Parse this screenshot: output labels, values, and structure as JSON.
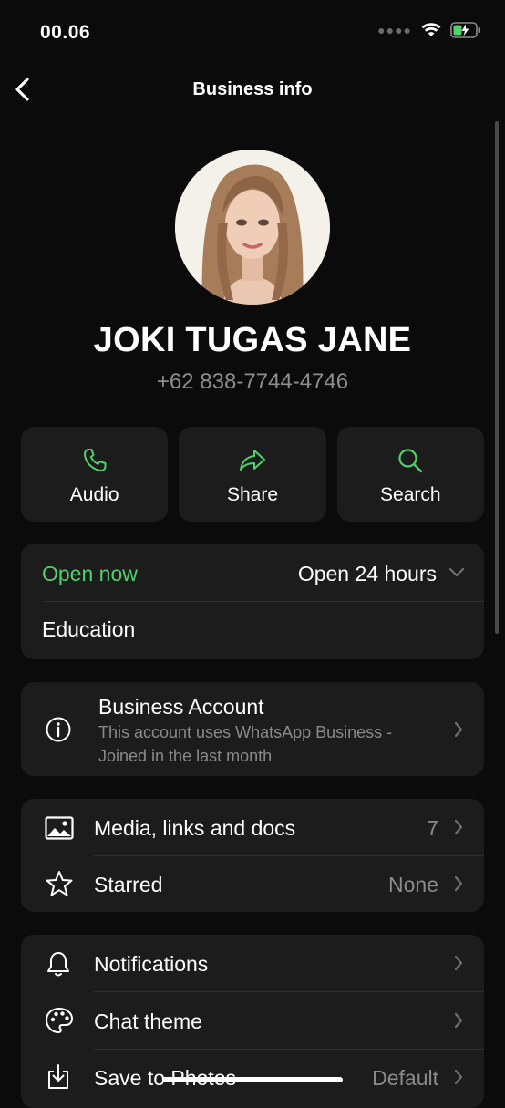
{
  "status_bar": {
    "time": "00.06"
  },
  "nav": {
    "title": "Business info"
  },
  "profile": {
    "name": "JOKI TUGAS JANE",
    "phone": "+62 838-7744-4746"
  },
  "actions": [
    {
      "label": "Audio",
      "icon": "phone-icon"
    },
    {
      "label": "Share",
      "icon": "share-icon"
    },
    {
      "label": "Search",
      "icon": "search-icon"
    }
  ],
  "hours": {
    "status": "Open now",
    "schedule": "Open 24 hours",
    "category": "Education"
  },
  "business_account": {
    "title": "Business Account",
    "line1": "This account uses WhatsApp Business -",
    "line2": "Joined in the last month"
  },
  "media": {
    "label": "Media, links and docs",
    "count": "7",
    "starred_label": "Starred",
    "starred_value": "None"
  },
  "settings": {
    "notifications": "Notifications",
    "chat_theme": "Chat theme",
    "save_to_photos": "Save to Photos",
    "save_to_photos_value": "Default"
  },
  "colors": {
    "accent": "#4fd16d",
    "background": "#0b0b0b",
    "card": "#1c1c1c"
  }
}
